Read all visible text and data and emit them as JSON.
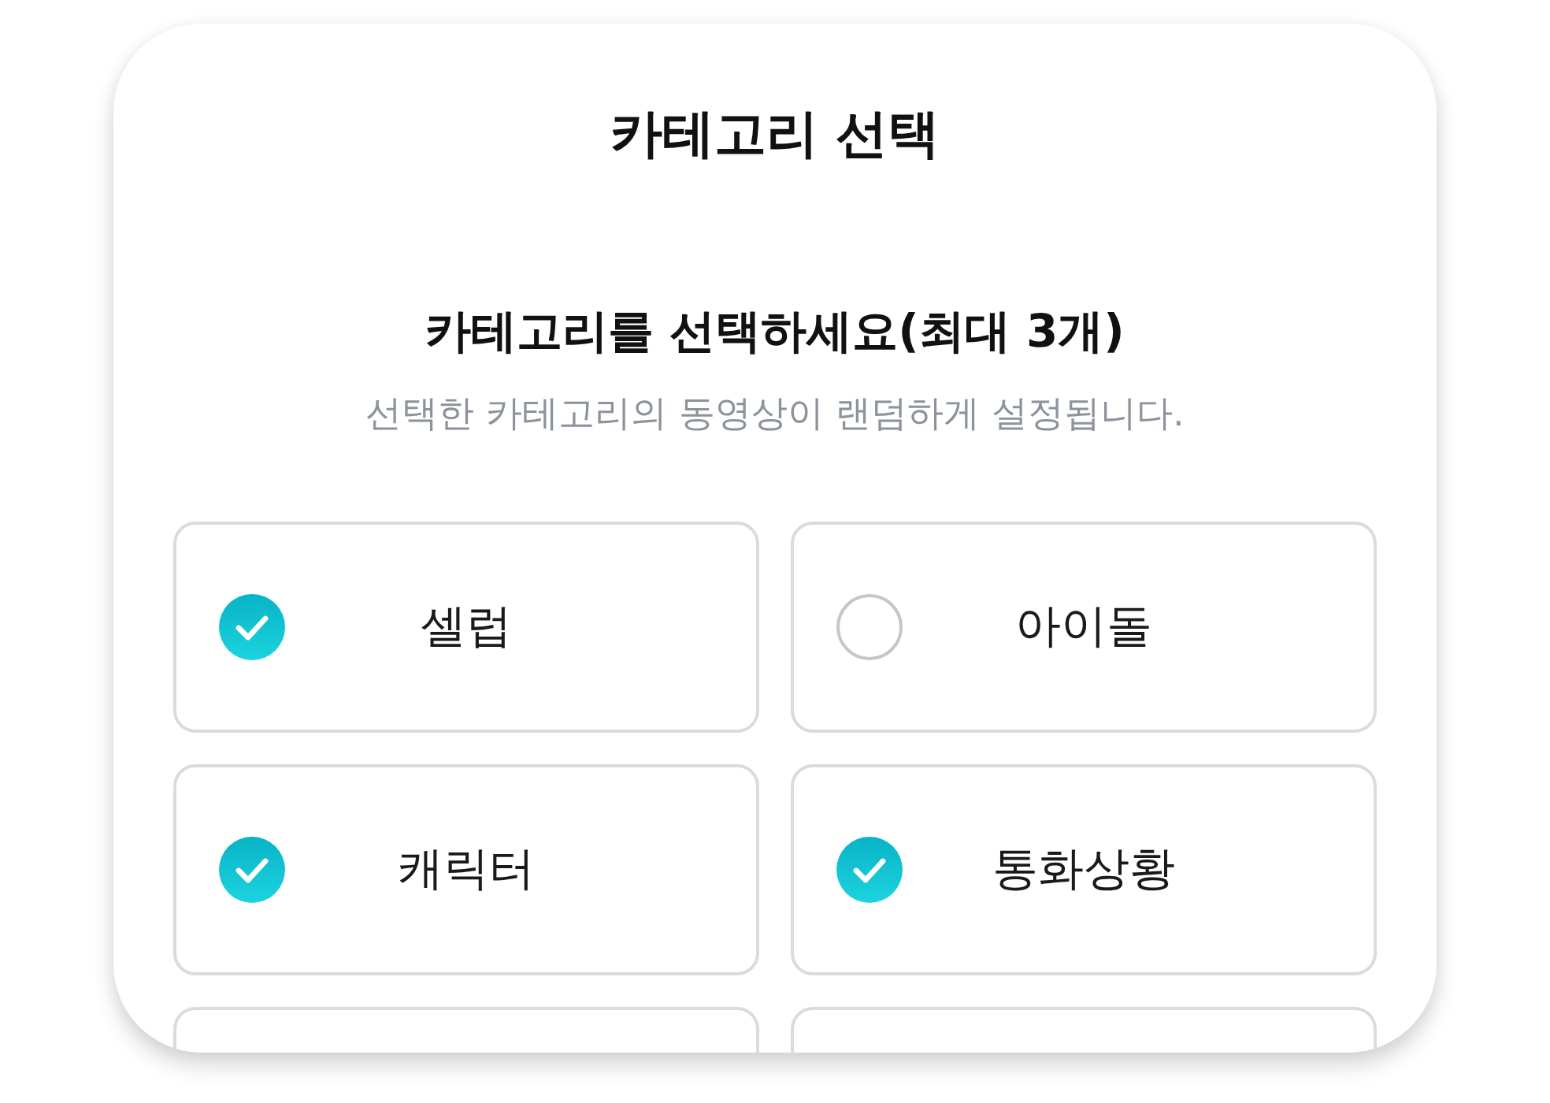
{
  "dialog": {
    "title": "카테고리 선택"
  },
  "prompt": {
    "heading": "카테고리를 선택하세요(최대 3개)",
    "description": "선택한 카테고리의 동영상이 랜덤하게 설정됩니다."
  },
  "options": [
    {
      "kind": "choice",
      "label": "셀럽",
      "checked": true
    },
    {
      "kind": "choice",
      "label": "아이돌",
      "checked": false
    },
    {
      "kind": "choice",
      "label": "캐릭터",
      "checked": true
    },
    {
      "kind": "choice",
      "label": "통화상황",
      "checked": true
    },
    {
      "kind": "clipped"
    },
    {
      "kind": "clipped"
    }
  ]
}
